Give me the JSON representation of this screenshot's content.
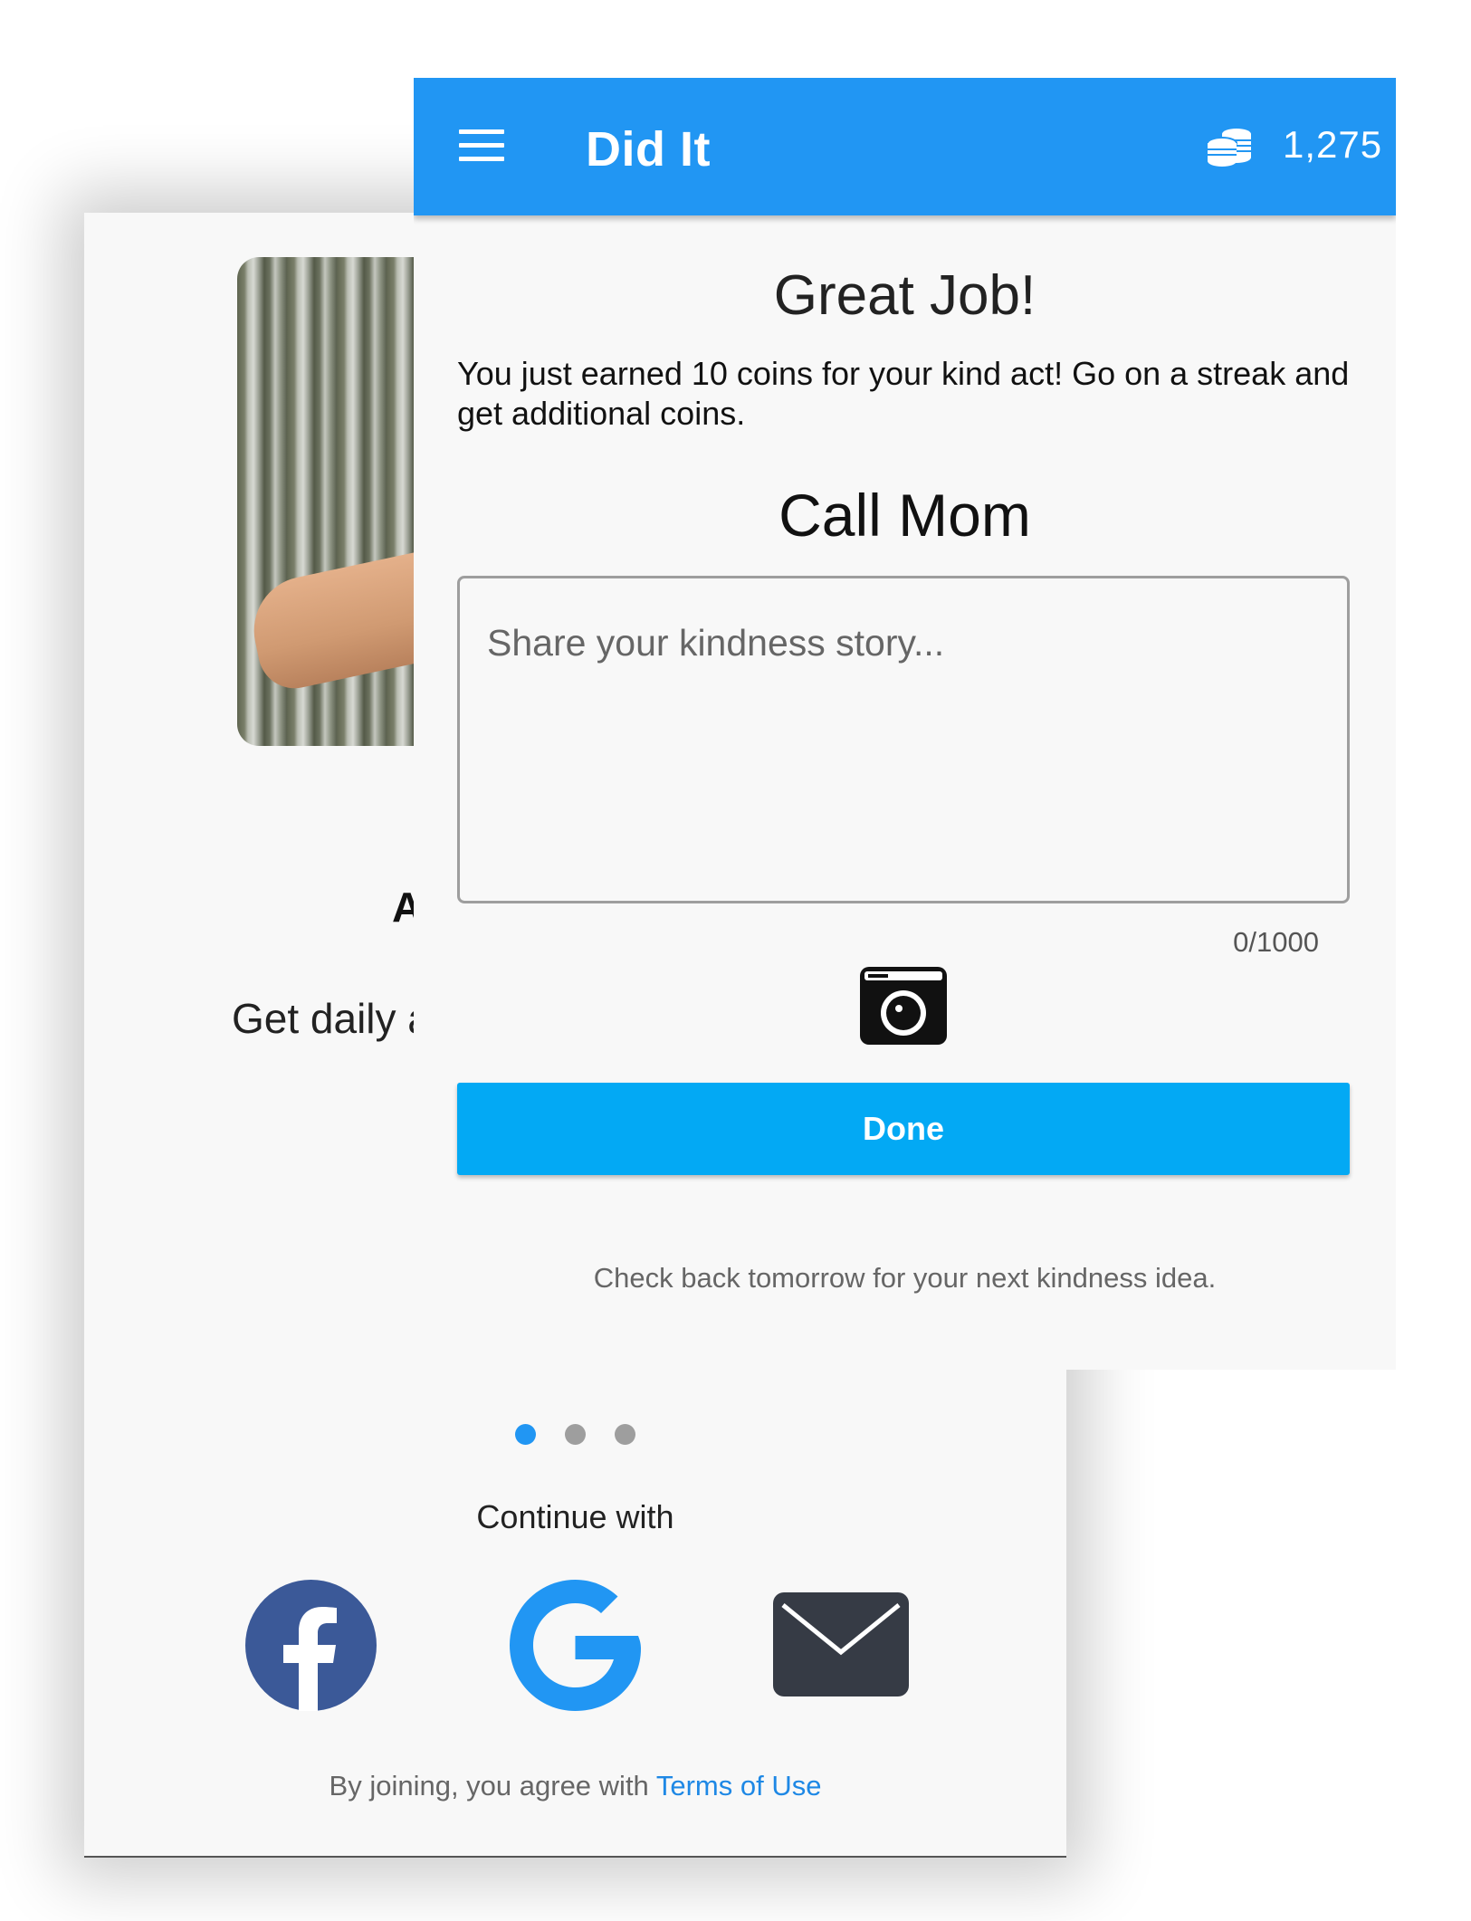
{
  "onboarding": {
    "heading_partial": "A",
    "subtitle_partial": "Get daily a",
    "carousel_dots": 3,
    "active_dot": 0,
    "continue_with": "Continue with",
    "social_buttons": [
      "facebook-icon",
      "google-icon",
      "email-icon"
    ],
    "terms_prefix": "By joining, you agree with ",
    "terms_link": "Terms of Use"
  },
  "app_bar": {
    "title": "Did It",
    "coin_count": "1,275",
    "menu_icon": "hamburger-menu-icon",
    "coins_icon": "coins-stack-icon"
  },
  "completion": {
    "heading": "Great Job!",
    "message": "You just earned 10 coins for your kind act! Go on a streak and get additional coins.",
    "task_title": "Call Mom",
    "story_placeholder": "Share your kindness story...",
    "story_value": "",
    "char_counter": "0/1000",
    "camera_icon": "camera-icon",
    "done_label": "Done",
    "footer_note": "Check back tomorrow for your next kindness idea."
  },
  "colors": {
    "app_bar": "#2196f3",
    "done_button": "#03a9f4",
    "facebook": "#3b5998",
    "google": "#2196f3",
    "email": "#363b45",
    "link": "#1e88e5",
    "active_dot": "#2196f3",
    "inactive_dot": "#9e9e9e"
  }
}
